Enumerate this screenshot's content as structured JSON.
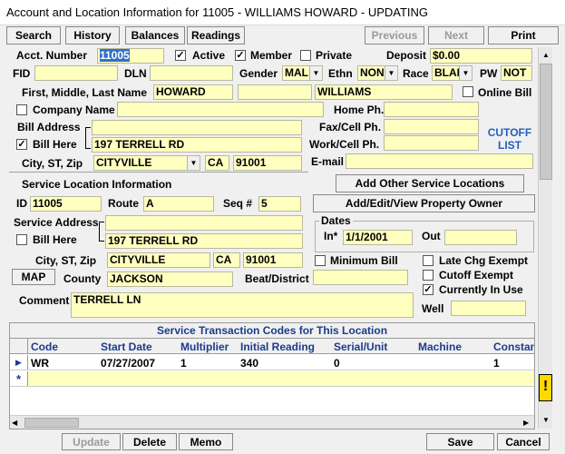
{
  "title": "Account and Location Information for 11005 - WILLIAMS HOWARD - UPDATING",
  "toolbar": {
    "search": "Search",
    "history": "History",
    "balances": "Balances",
    "readings": "Readings",
    "previous": "Previous",
    "next": "Next",
    "print": "Print"
  },
  "account": {
    "acct_label": "Acct. Number",
    "acct_value": "11005",
    "active_label": "Active",
    "member_label": "Member",
    "private_label": "Private",
    "deposit_label": "Deposit",
    "deposit_value": "$0.00",
    "fid_label": "FID",
    "dln_label": "DLN",
    "gender_label": "Gender",
    "gender_value": "MAL",
    "ethn_label": "Ethn",
    "ethn_value": "NON",
    "race_label": "Race",
    "race_value": "BLAI",
    "pw_label": "PW",
    "pw_value": "NOT",
    "name_label": "First, Middle, Last Name",
    "first": "HOWARD",
    "middle": "",
    "last": "WILLIAMS",
    "online_bill_label": "Online Bill",
    "company_label": "Company Name",
    "home_ph_label": "Home Ph.",
    "bill_address_label": "Bill Address",
    "fax_label": "Fax/Cell Ph.",
    "bill_here_label": "Bill Here",
    "bill_address_line2": "197 TERRELL RD",
    "work_label": "Work/Cell Ph.",
    "cutoff_list": "CUTOFF LIST",
    "city_label": "City, ST, Zip",
    "city": "CITYVILLE",
    "state": "CA",
    "zip": "91001",
    "email_label": "E-mail"
  },
  "service": {
    "section_label": "Service Location Information",
    "add_other_label": "Add Other Service Locations",
    "add_edit_owner_label": "Add/Edit/View Property Owner",
    "id_label": "ID",
    "id_value": "11005",
    "route_label": "Route",
    "route_value": "A",
    "seq_label": "Seq #",
    "seq_value": "5",
    "address_label": "Service Address",
    "address_line2": "197 TERRELL RD",
    "bill_here_label": "Bill Here",
    "dates_label": "Dates",
    "in_label": "In*",
    "in_value": "1/1/2001",
    "out_label": "Out",
    "city_label": "City, ST, Zip",
    "city": "CITYVILLE",
    "state": "CA",
    "zip": "91001",
    "min_bill_label": "Minimum Bill",
    "map_label": "MAP",
    "county_label": "County",
    "county_value": "JACKSON",
    "beat_label": "Beat/District",
    "late_chg_label": "Late Chg Exempt",
    "cutoff_exempt_label": "Cutoff Exempt",
    "in_use_label": "Currently In Use",
    "comment_label": "Comment",
    "comment_value": "TERRELL LN",
    "well_label": "Well"
  },
  "grid": {
    "caption": "Service Transaction Codes for This Location",
    "headers": [
      "Code",
      "Start Date",
      "Multiplier",
      "Initial Reading",
      "Serial/Unit",
      "Machine",
      "Constan"
    ],
    "row": [
      "WR",
      "07/27/2007",
      "1",
      "340",
      "0",
      "",
      "1"
    ]
  },
  "footer": {
    "update": "Update",
    "delete": "Delete",
    "memo": "Memo",
    "save": "Save",
    "cancel": "Cancel"
  }
}
